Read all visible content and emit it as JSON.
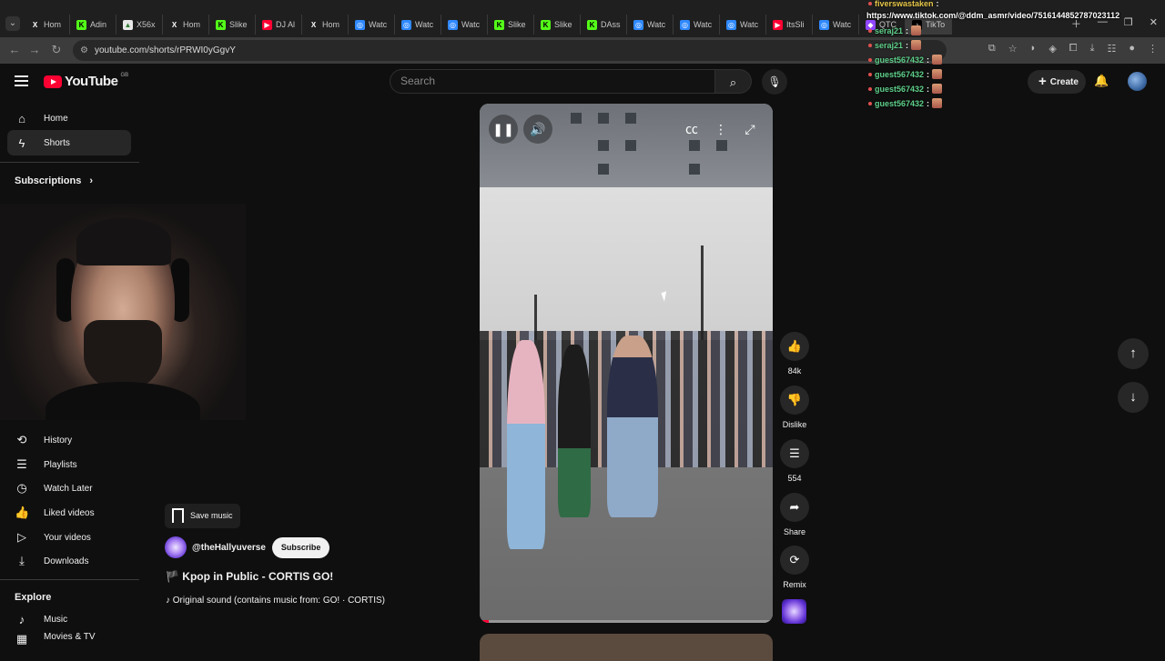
{
  "browser": {
    "tabs": [
      {
        "label": "Hom",
        "fav": "X",
        "favbg": "#1f1f1f",
        "favfg": "#ffffff"
      },
      {
        "label": "Adin",
        "fav": "K",
        "favbg": "#53fc18",
        "favfg": "#000000"
      },
      {
        "label": "X56x",
        "fav": "▲",
        "favbg": "#e8e8e8",
        "favfg": "#2f7d32"
      },
      {
        "label": "Hom",
        "fav": "X",
        "favbg": "#1f1f1f",
        "favfg": "#ffffff"
      },
      {
        "label": "Slike",
        "fav": "K",
        "favbg": "#53fc18",
        "favfg": "#000000"
      },
      {
        "label": "DJ Al",
        "fav": "▶",
        "favbg": "#ff0033",
        "favfg": "#ffffff"
      },
      {
        "label": "Hom",
        "fav": "X",
        "favbg": "#1f1f1f",
        "favfg": "#ffffff"
      },
      {
        "label": "Watc",
        "fav": "◎",
        "favbg": "#2f89ff",
        "favfg": "#ffffff"
      },
      {
        "label": "Watc",
        "fav": "◎",
        "favbg": "#2f89ff",
        "favfg": "#ffffff"
      },
      {
        "label": "Watc",
        "fav": "◎",
        "favbg": "#2f89ff",
        "favfg": "#ffffff"
      },
      {
        "label": "Slike",
        "fav": "K",
        "favbg": "#53fc18",
        "favfg": "#000000"
      },
      {
        "label": "Slike",
        "fav": "K",
        "favbg": "#53fc18",
        "favfg": "#000000"
      },
      {
        "label": "DAss",
        "fav": "K",
        "favbg": "#53fc18",
        "favfg": "#000000"
      },
      {
        "label": "Watc",
        "fav": "◎",
        "favbg": "#2f89ff",
        "favfg": "#ffffff"
      },
      {
        "label": "Watc",
        "fav": "◎",
        "favbg": "#2f89ff",
        "favfg": "#ffffff"
      },
      {
        "label": "Watc",
        "fav": "◎",
        "favbg": "#2f89ff",
        "favfg": "#ffffff"
      },
      {
        "label": "ItsSli",
        "fav": "▶",
        "favbg": "#ff0033",
        "favfg": "#ffffff"
      },
      {
        "label": "Watc",
        "fav": "◎",
        "favbg": "#2f89ff",
        "favfg": "#ffffff"
      },
      {
        "label": "QTC",
        "fav": "◆",
        "favbg": "#9146ff",
        "favfg": "#ffffff"
      },
      {
        "label": "TikTo",
        "fav": "♪",
        "favbg": "#000000",
        "favfg": "#ffffff"
      }
    ],
    "url": "youtube.com/shorts/rPRWI0yGgvY"
  },
  "header": {
    "logo_word": "YouTube",
    "region": "GB",
    "search_placeholder": "Search",
    "create_label": "Create"
  },
  "sidebar": {
    "home": "Home",
    "shorts": "Shorts",
    "subscriptions": "Subscriptions",
    "you_items": [
      {
        "label": "History",
        "icon": "history-icon",
        "glyph": "⟲"
      },
      {
        "label": "Playlists",
        "icon": "playlists-icon",
        "glyph": "☰"
      },
      {
        "label": "Watch Later",
        "icon": "watch-later-icon",
        "glyph": "◷"
      },
      {
        "label": "Liked videos",
        "icon": "like-icon",
        "glyph": "👍"
      },
      {
        "label": "Your videos",
        "icon": "your-videos-icon",
        "glyph": "▷"
      },
      {
        "label": "Downloads",
        "icon": "download-icon",
        "glyph": "⤓"
      }
    ],
    "explore": "Explore",
    "music": "Music",
    "movies_partial": "Movies & TV"
  },
  "short": {
    "save_music": "Save music",
    "channel": "@theHallyuverse",
    "subscribe": "Subscribe",
    "flag": "🏴",
    "title": "Kpop in Public - CORTIS GO!",
    "sound": "♪ Original sound (contains music from: GO! · CORTIS)",
    "progress": 0.03
  },
  "actions": {
    "likes": "84k",
    "dislike": "Dislike",
    "comments": "554",
    "share": "Share",
    "remix": "Remix"
  },
  "chat": {
    "url": "https://www.tiktok.com/@ddm_asmr/video/7516144852787023112",
    "messages": [
      {
        "user": "fiverswastaken"
      },
      {
        "user": "seraj21"
      },
      {
        "user": "seraj21"
      },
      {
        "user": "guest567432"
      },
      {
        "user": "guest567432"
      },
      {
        "user": "guest567432"
      },
      {
        "user": "guest567432"
      }
    ]
  }
}
